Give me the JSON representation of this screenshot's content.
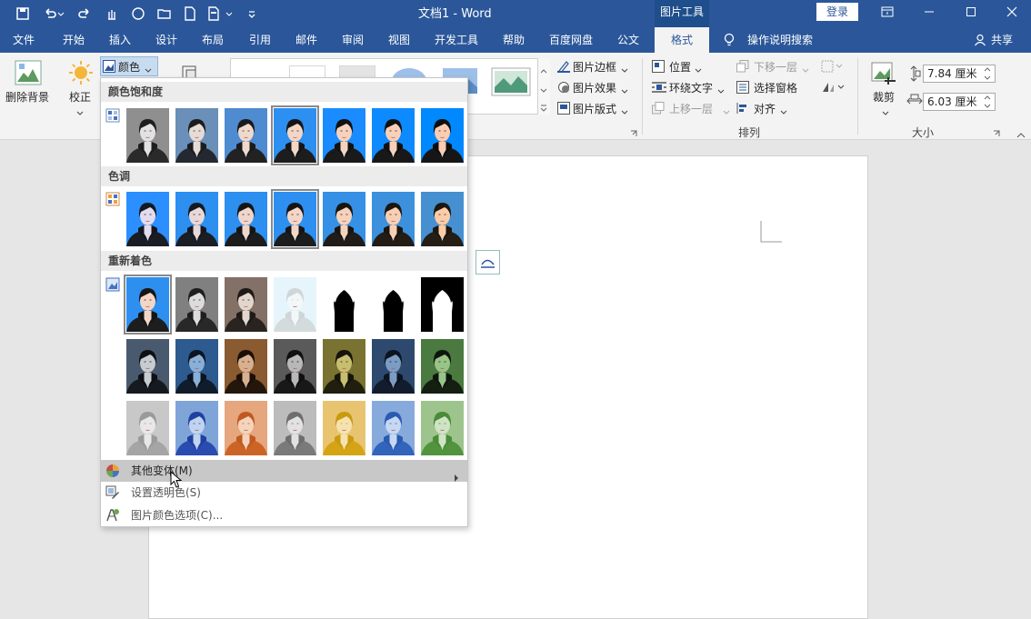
{
  "title": {
    "doc": "文档1",
    "sep": "-",
    "app": "Word",
    "context": "图片工具",
    "login": "登录"
  },
  "tabs": [
    "文件",
    "开始",
    "插入",
    "设计",
    "布局",
    "引用",
    "邮件",
    "审阅",
    "视图",
    "开发工具",
    "帮助",
    "百度网盘",
    "公文",
    "格式"
  ],
  "active_tab": "格式",
  "tell_me": "操作说明搜索",
  "share": "共享",
  "ribbon": {
    "remove_bg": "删除背景",
    "correct": "校正",
    "color": "颜色",
    "border": "图片边框",
    "effects": "图片效果",
    "layout": "图片版式",
    "position": "位置",
    "wrap": "环绕文字",
    "forward": "上移一层",
    "backward": "下移一层",
    "selection": "选择窗格",
    "align": "对齐",
    "crop": "裁剪",
    "height": "7.84 厘米",
    "width": "6.03 厘米",
    "group_arrange": "排列",
    "group_size": "大小"
  },
  "menu": {
    "saturation": "颜色饱和度",
    "tone": "色调",
    "recolor": "重新着色",
    "more_variations": "其他变体(M)",
    "set_transparent": "设置透明色(S)",
    "color_options": "图片颜色选项(C)..."
  },
  "colors": {
    "title_bar": "#2b579a",
    "ribbon_bg": "#f3f3f3",
    "photo_blue": "#2d8ff0"
  }
}
